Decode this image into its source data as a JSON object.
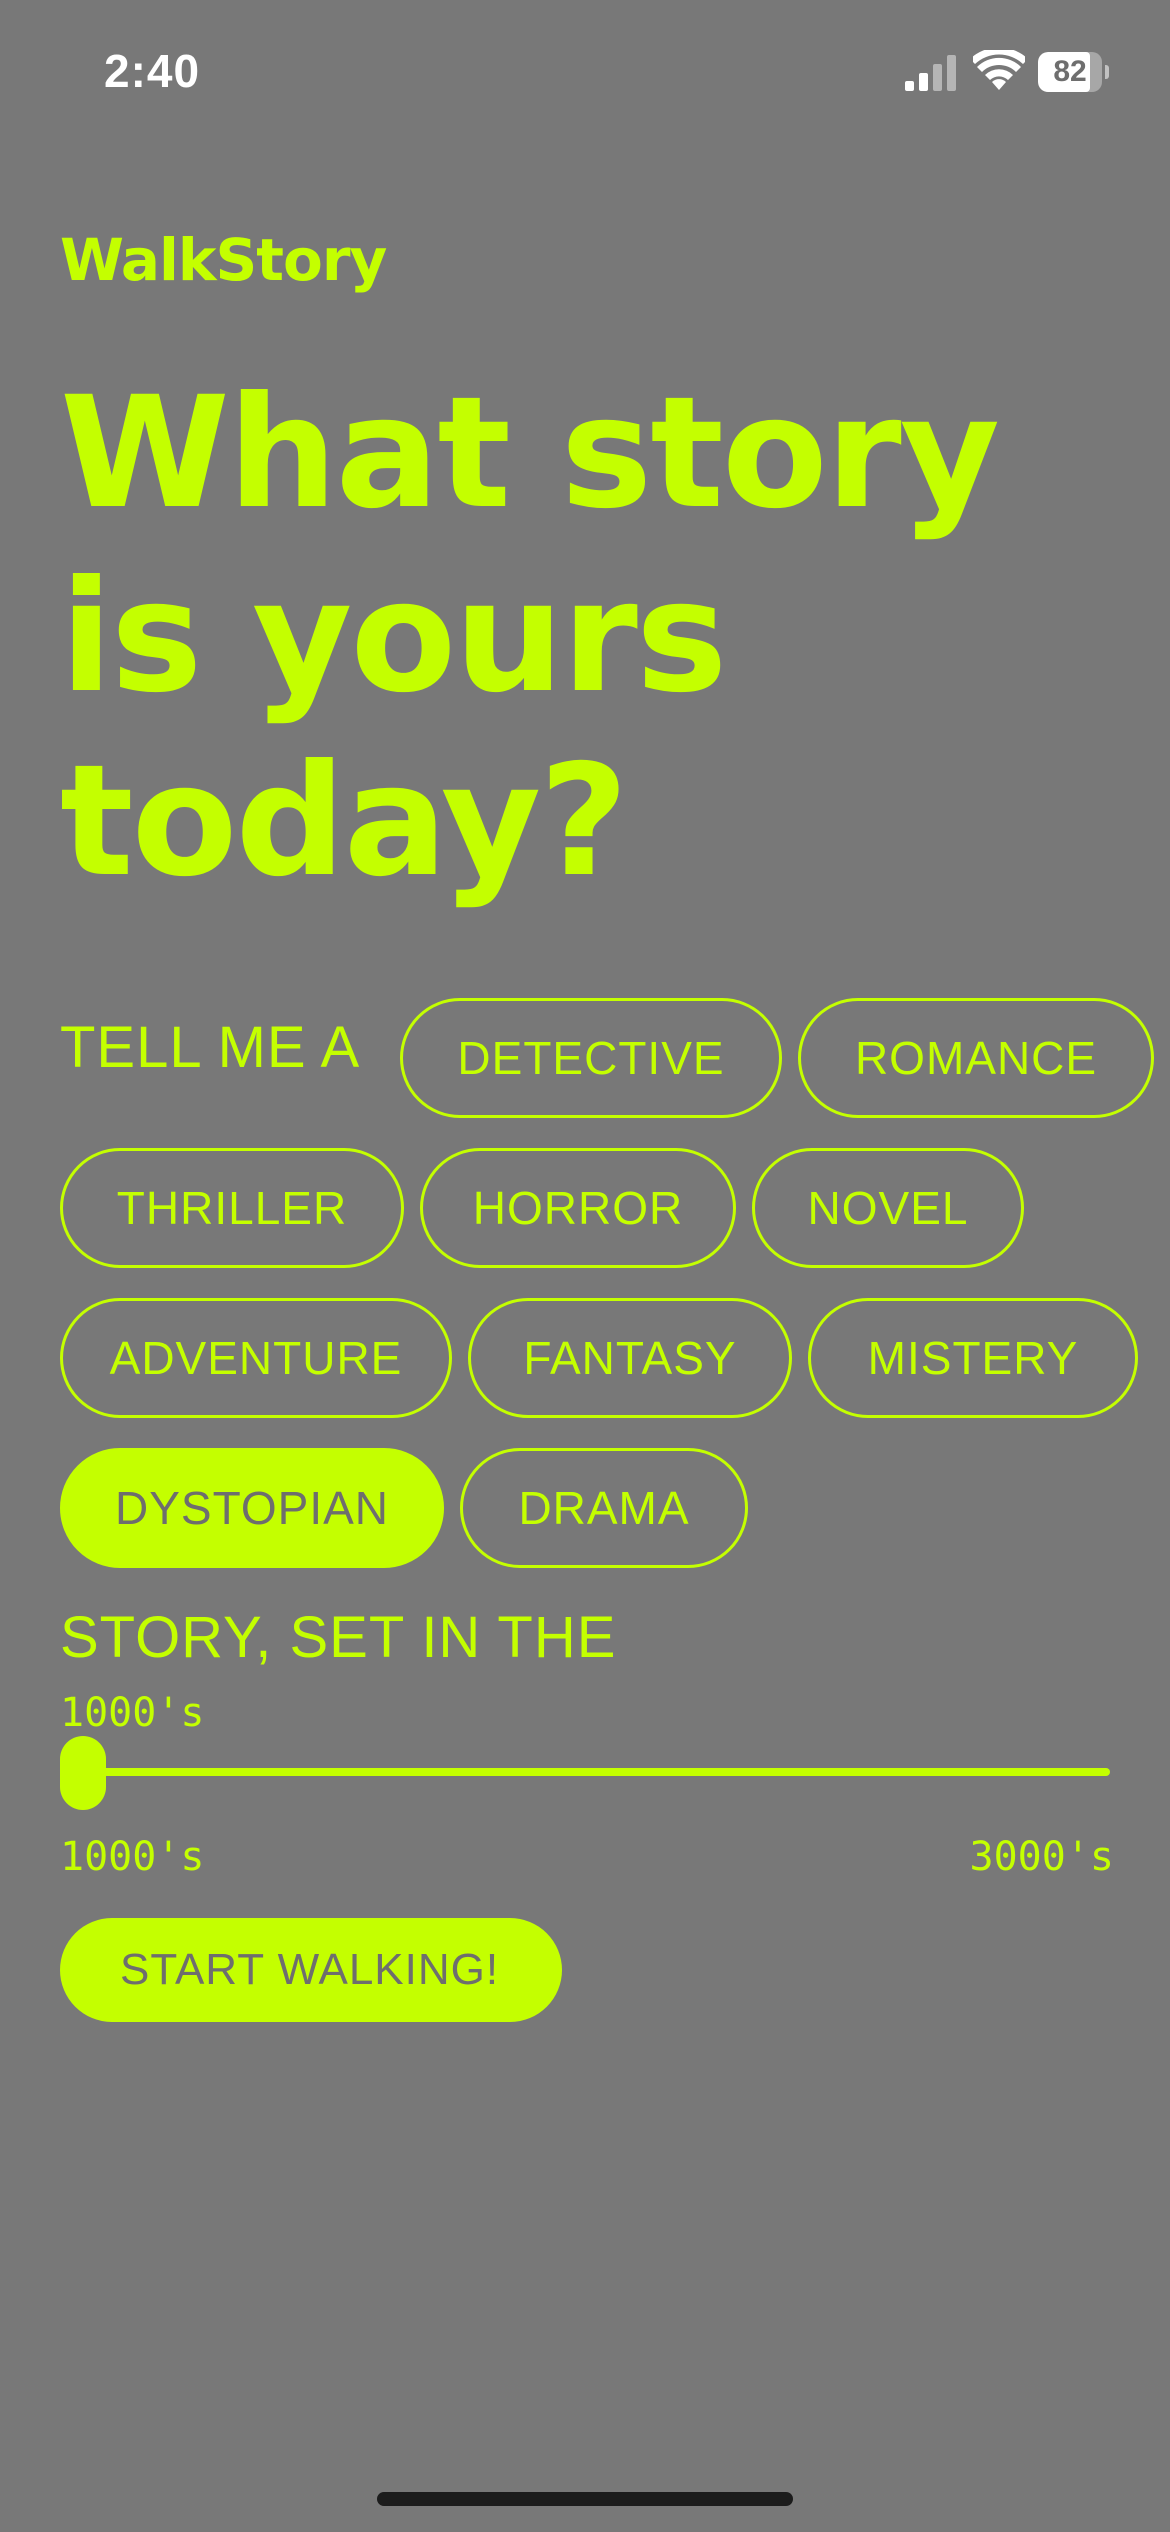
{
  "status_bar": {
    "time": "2:40",
    "battery_level": 82,
    "battery_text": "82",
    "signal_bars_active": 2,
    "signal_bars_total": 4
  },
  "app": {
    "logo": "WalkStory",
    "headline": "What story is yours today?",
    "accent_color": "#c4ff00",
    "background_color": "#787878"
  },
  "genre_prompt": "TELL ME A",
  "genres": [
    {
      "label": "DETECTIVE",
      "selected": false
    },
    {
      "label": "ROMANCE",
      "selected": false
    },
    {
      "label": "THRILLER",
      "selected": false
    },
    {
      "label": "HORROR",
      "selected": false
    },
    {
      "label": "NOVEL",
      "selected": false
    },
    {
      "label": "ADVENTURE",
      "selected": false
    },
    {
      "label": "FANTASY",
      "selected": false
    },
    {
      "label": "MISTERY",
      "selected": false
    },
    {
      "label": "DYSTOPIAN",
      "selected": true
    },
    {
      "label": "DRAMA",
      "selected": false
    }
  ],
  "era": {
    "label": "STORY, SET IN THE",
    "current_value": "1000's",
    "min_label": "1000's",
    "max_label": "3000's",
    "slider_fraction": 0.0
  },
  "start_button_label": "START WALKING!"
}
